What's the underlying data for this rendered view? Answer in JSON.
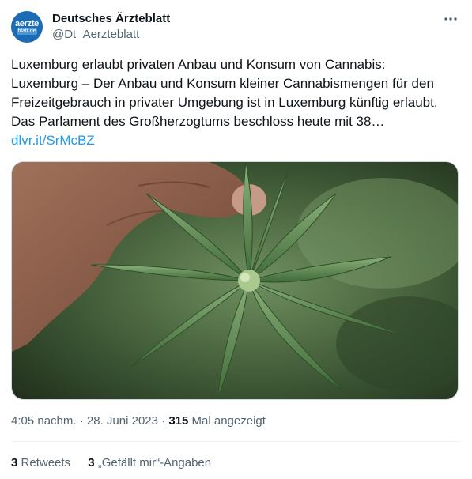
{
  "account": {
    "avatar_line1": "aerzte",
    "avatar_line2": "blatt.de",
    "display_name": "Deutsches Ärzteblatt",
    "handle": "@Dt_Aerzteblatt"
  },
  "menu_icon": "more-horizontal-icon",
  "tweet": {
    "lines": [
      "Luxemburg erlaubt privaten Anbau und Konsum von Cannabis:",
      "Luxemburg – Der Anbau und Konsum kleiner Cannabismengen für den",
      "Freizeitgebrauch in privater Umgebung ist in Luxemburg künftig erlaubt.",
      "Das Parlament des Großherzogtums beschloss heute mit 38…"
    ],
    "link": "dlvr.it/SrMcBZ"
  },
  "media": {
    "subject": "hand-holding-cannabis-plant-photo"
  },
  "meta": {
    "time": "4:05 nachm.",
    "separator": " · ",
    "date": "28. Juni 2023",
    "views": "315",
    "views_label": "Mal angezeigt"
  },
  "stats": {
    "retweets_count": "3",
    "retweets_label": "Retweets",
    "likes_count": "3",
    "likes_label": "„Gefällt mir“-Angaben"
  },
  "colors": {
    "accent": "#1d9bf0",
    "text": "#0f1419",
    "secondary": "#536471",
    "border": "#eff3f4"
  }
}
